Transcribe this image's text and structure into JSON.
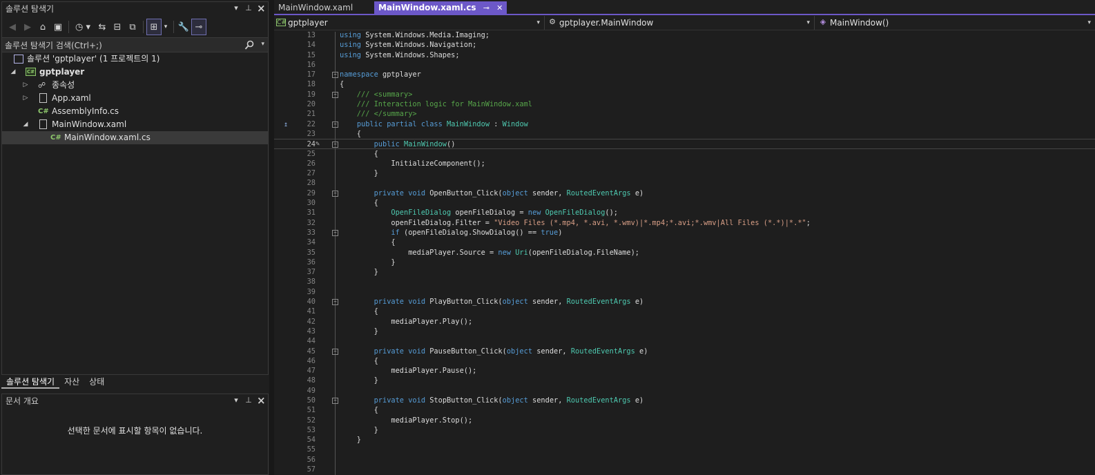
{
  "solution_explorer": {
    "title": "솔루션 탐색기",
    "pin_glyph": "▾",
    "search_placeholder": "솔루션 탐색기 검색(Ctrl+;)",
    "tree": [
      {
        "label": "솔루션 'gptplayer' (1 프로젝트의 1)",
        "icon": "solution-icon"
      },
      {
        "label": "gptplayer",
        "icon": "csharp-project-icon"
      },
      {
        "label": "종속성",
        "icon": "dependencies-icon"
      },
      {
        "label": "App.xaml",
        "icon": "xaml-file-icon"
      },
      {
        "label": "AssemblyInfo.cs",
        "icon": "csharp-file-icon",
        "icon_text": "C#"
      },
      {
        "label": "MainWindow.xaml",
        "icon": "xaml-file-icon"
      },
      {
        "label": "MainWindow.xaml.cs",
        "icon": "csharp-file-icon",
        "icon_text": "C#"
      }
    ],
    "tabs": [
      "솔루션 탐색기",
      "자산",
      "상태"
    ]
  },
  "document_outline": {
    "title": "문서 개요",
    "empty_message": "선택한 문서에 표시할 항목이 없습니다."
  },
  "editor": {
    "tabs": [
      {
        "label": "MainWindow.xaml",
        "active": false
      },
      {
        "label": "MainWindow.xaml.cs",
        "active": true
      }
    ],
    "nav": {
      "project": "gptplayer",
      "type": "gptplayer.MainWindow",
      "member": "MainWindow()"
    },
    "current_line": 24,
    "lines": [
      {
        "n": "13",
        "text": "using System.Windows.Media.Imaging;"
      },
      {
        "n": "14",
        "text": "using System.Windows.Navigation;"
      },
      {
        "n": "15",
        "text": "using System.Windows.Shapes;"
      },
      {
        "n": "16",
        "text": ""
      },
      {
        "n": "17",
        "text": "namespace gptplayer"
      },
      {
        "n": "18",
        "text": "{"
      },
      {
        "n": "19",
        "text": "    /// <summary>"
      },
      {
        "n": "20",
        "text": "    /// Interaction logic for MainWindow.xaml"
      },
      {
        "n": "21",
        "text": "    /// </summary>"
      },
      {
        "n": "22",
        "text": "    public partial class MainWindow : Window"
      },
      {
        "n": "23",
        "text": "    {"
      },
      {
        "n": "24",
        "text": "        public MainWindow()"
      },
      {
        "n": "25",
        "text": "        {"
      },
      {
        "n": "26",
        "text": "            InitializeComponent();"
      },
      {
        "n": "27",
        "text": "        }"
      },
      {
        "n": "28",
        "text": ""
      },
      {
        "n": "29",
        "text": "        private void OpenButton_Click(object sender, RoutedEventArgs e)"
      },
      {
        "n": "30",
        "text": "        {"
      },
      {
        "n": "31",
        "text": "            OpenFileDialog openFileDialog = new OpenFileDialog();"
      },
      {
        "n": "32",
        "text": "            openFileDialog.Filter = \"Video Files (*.mp4, *.avi, *.wmv)|*.mp4;*.avi;*.wmv|All Files (*.*)|*.*\";"
      },
      {
        "n": "33",
        "text": "            if (openFileDialog.ShowDialog() == true)"
      },
      {
        "n": "34",
        "text": "            {"
      },
      {
        "n": "35",
        "text": "                mediaPlayer.Source = new Uri(openFileDialog.FileName);"
      },
      {
        "n": "36",
        "text": "            }"
      },
      {
        "n": "37",
        "text": "        }"
      },
      {
        "n": "38",
        "text": ""
      },
      {
        "n": "39",
        "text": ""
      },
      {
        "n": "40",
        "text": "        private void PlayButton_Click(object sender, RoutedEventArgs e)"
      },
      {
        "n": "41",
        "text": "        {"
      },
      {
        "n": "42",
        "text": "            mediaPlayer.Play();"
      },
      {
        "n": "43",
        "text": "        }"
      },
      {
        "n": "44",
        "text": ""
      },
      {
        "n": "45",
        "text": "        private void PauseButton_Click(object sender, RoutedEventArgs e)"
      },
      {
        "n": "46",
        "text": "        {"
      },
      {
        "n": "47",
        "text": "            mediaPlayer.Pause();"
      },
      {
        "n": "48",
        "text": "        }"
      },
      {
        "n": "49",
        "text": ""
      },
      {
        "n": "50",
        "text": "        private void StopButton_Click(object sender, RoutedEventArgs e)"
      },
      {
        "n": "51",
        "text": "        {"
      },
      {
        "n": "52",
        "text": "            mediaPlayer.Stop();"
      },
      {
        "n": "53",
        "text": "        }"
      },
      {
        "n": "54",
        "text": "    }"
      },
      {
        "n": "55",
        "text": ""
      },
      {
        "n": "56",
        "text": ""
      },
      {
        "n": "57",
        "text": ""
      }
    ],
    "folds": [
      "17",
      "19",
      "22",
      "24",
      "29",
      "33",
      "40",
      "45",
      "50"
    ]
  },
  "colors": {
    "keyword": "#569cd6",
    "type": "#4ec9b0",
    "comment": "#57a64a",
    "string": "#d69d85",
    "accent": "#6c58c8"
  }
}
